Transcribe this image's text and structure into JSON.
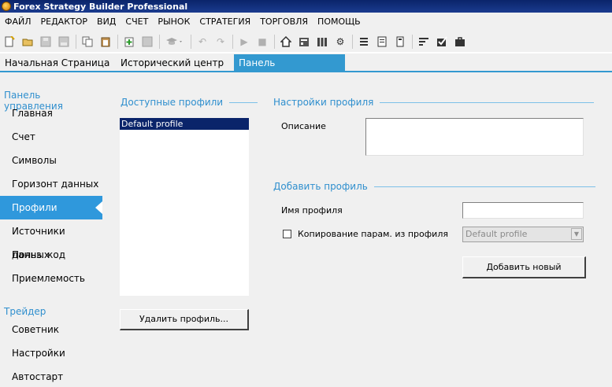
{
  "window": {
    "title": "Forex Strategy Builder Professional"
  },
  "menu": {
    "items": [
      "ФАЙЛ",
      "РЕДАКТОР",
      "ВИД",
      "СЧЕТ",
      "РЫНОК",
      "СТРАТЕГИЯ",
      "ТОРГОВЛЯ",
      "ПОМОЩЬ"
    ]
  },
  "tabs": {
    "home": "Начальная Страница",
    "history": "Исторический центр",
    "control_panel": "Панель управления",
    "close_glyph": "✕"
  },
  "sidebar": {
    "section_control": "Панель управления",
    "items_control": [
      "Главная",
      "Счет",
      "Символы",
      "Горизонт данных",
      "Профили",
      "Источники данных",
      "Польз. код",
      "Приемлемость"
    ],
    "active_item": "Профили",
    "section_trader": "Трейдер",
    "items_trader": [
      "Советник",
      "Настройки",
      "Автостарт"
    ]
  },
  "profiles": {
    "available_title": "Доступные профили",
    "list": [
      "Default profile"
    ],
    "selected": "Default profile",
    "delete_button": "Удалить профиль..."
  },
  "profile_settings": {
    "title": "Настройки профиля",
    "description_label": "Описание",
    "description_value": ""
  },
  "add_profile": {
    "title": "Добавить профиль",
    "name_label": "Имя профиля",
    "name_value": "",
    "copy_label": "Копирование парам. из профиля",
    "copy_checked": false,
    "copy_source": "Default profile",
    "add_button": "Добавить новый"
  },
  "colors": {
    "accent": "#2f98dc",
    "section_text": "#2f8fce",
    "selection": "#0a246a"
  }
}
